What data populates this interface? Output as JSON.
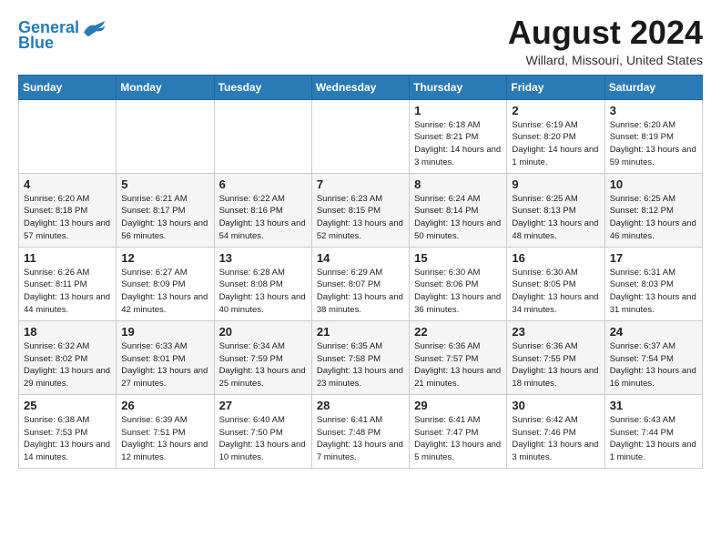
{
  "header": {
    "logo_line1": "General",
    "logo_line2": "Blue",
    "month_title": "August 2024",
    "location": "Willard, Missouri, United States"
  },
  "weekdays": [
    "Sunday",
    "Monday",
    "Tuesday",
    "Wednesday",
    "Thursday",
    "Friday",
    "Saturday"
  ],
  "weeks": [
    [
      {
        "day": "",
        "info": ""
      },
      {
        "day": "",
        "info": ""
      },
      {
        "day": "",
        "info": ""
      },
      {
        "day": "",
        "info": ""
      },
      {
        "day": "1",
        "info": "Sunrise: 6:18 AM\nSunset: 8:21 PM\nDaylight: 14 hours\nand 3 minutes."
      },
      {
        "day": "2",
        "info": "Sunrise: 6:19 AM\nSunset: 8:20 PM\nDaylight: 14 hours\nand 1 minute."
      },
      {
        "day": "3",
        "info": "Sunrise: 6:20 AM\nSunset: 8:19 PM\nDaylight: 13 hours\nand 59 minutes."
      }
    ],
    [
      {
        "day": "4",
        "info": "Sunrise: 6:20 AM\nSunset: 8:18 PM\nDaylight: 13 hours\nand 57 minutes."
      },
      {
        "day": "5",
        "info": "Sunrise: 6:21 AM\nSunset: 8:17 PM\nDaylight: 13 hours\nand 56 minutes."
      },
      {
        "day": "6",
        "info": "Sunrise: 6:22 AM\nSunset: 8:16 PM\nDaylight: 13 hours\nand 54 minutes."
      },
      {
        "day": "7",
        "info": "Sunrise: 6:23 AM\nSunset: 8:15 PM\nDaylight: 13 hours\nand 52 minutes."
      },
      {
        "day": "8",
        "info": "Sunrise: 6:24 AM\nSunset: 8:14 PM\nDaylight: 13 hours\nand 50 minutes."
      },
      {
        "day": "9",
        "info": "Sunrise: 6:25 AM\nSunset: 8:13 PM\nDaylight: 13 hours\nand 48 minutes."
      },
      {
        "day": "10",
        "info": "Sunrise: 6:25 AM\nSunset: 8:12 PM\nDaylight: 13 hours\nand 46 minutes."
      }
    ],
    [
      {
        "day": "11",
        "info": "Sunrise: 6:26 AM\nSunset: 8:11 PM\nDaylight: 13 hours\nand 44 minutes."
      },
      {
        "day": "12",
        "info": "Sunrise: 6:27 AM\nSunset: 8:09 PM\nDaylight: 13 hours\nand 42 minutes."
      },
      {
        "day": "13",
        "info": "Sunrise: 6:28 AM\nSunset: 8:08 PM\nDaylight: 13 hours\nand 40 minutes."
      },
      {
        "day": "14",
        "info": "Sunrise: 6:29 AM\nSunset: 8:07 PM\nDaylight: 13 hours\nand 38 minutes."
      },
      {
        "day": "15",
        "info": "Sunrise: 6:30 AM\nSunset: 8:06 PM\nDaylight: 13 hours\nand 36 minutes."
      },
      {
        "day": "16",
        "info": "Sunrise: 6:30 AM\nSunset: 8:05 PM\nDaylight: 13 hours\nand 34 minutes."
      },
      {
        "day": "17",
        "info": "Sunrise: 6:31 AM\nSunset: 8:03 PM\nDaylight: 13 hours\nand 31 minutes."
      }
    ],
    [
      {
        "day": "18",
        "info": "Sunrise: 6:32 AM\nSunset: 8:02 PM\nDaylight: 13 hours\nand 29 minutes."
      },
      {
        "day": "19",
        "info": "Sunrise: 6:33 AM\nSunset: 8:01 PM\nDaylight: 13 hours\nand 27 minutes."
      },
      {
        "day": "20",
        "info": "Sunrise: 6:34 AM\nSunset: 7:59 PM\nDaylight: 13 hours\nand 25 minutes."
      },
      {
        "day": "21",
        "info": "Sunrise: 6:35 AM\nSunset: 7:58 PM\nDaylight: 13 hours\nand 23 minutes."
      },
      {
        "day": "22",
        "info": "Sunrise: 6:36 AM\nSunset: 7:57 PM\nDaylight: 13 hours\nand 21 minutes."
      },
      {
        "day": "23",
        "info": "Sunrise: 6:36 AM\nSunset: 7:55 PM\nDaylight: 13 hours\nand 18 minutes."
      },
      {
        "day": "24",
        "info": "Sunrise: 6:37 AM\nSunset: 7:54 PM\nDaylight: 13 hours\nand 16 minutes."
      }
    ],
    [
      {
        "day": "25",
        "info": "Sunrise: 6:38 AM\nSunset: 7:53 PM\nDaylight: 13 hours\nand 14 minutes."
      },
      {
        "day": "26",
        "info": "Sunrise: 6:39 AM\nSunset: 7:51 PM\nDaylight: 13 hours\nand 12 minutes."
      },
      {
        "day": "27",
        "info": "Sunrise: 6:40 AM\nSunset: 7:50 PM\nDaylight: 13 hours\nand 10 minutes."
      },
      {
        "day": "28",
        "info": "Sunrise: 6:41 AM\nSunset: 7:48 PM\nDaylight: 13 hours\nand 7 minutes."
      },
      {
        "day": "29",
        "info": "Sunrise: 6:41 AM\nSunset: 7:47 PM\nDaylight: 13 hours\nand 5 minutes."
      },
      {
        "day": "30",
        "info": "Sunrise: 6:42 AM\nSunset: 7:46 PM\nDaylight: 13 hours\nand 3 minutes."
      },
      {
        "day": "31",
        "info": "Sunrise: 6:43 AM\nSunset: 7:44 PM\nDaylight: 13 hours\nand 1 minute."
      }
    ]
  ]
}
